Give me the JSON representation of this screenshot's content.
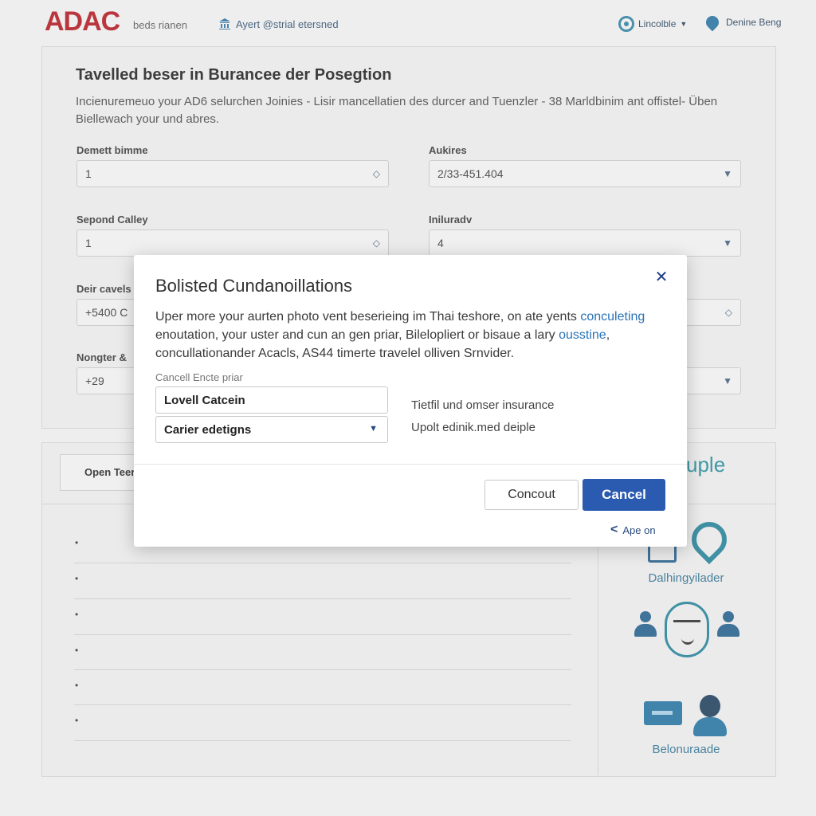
{
  "header": {
    "logo": "ADAC",
    "logo_sub": "beds rianen",
    "link": "Ayert @strial etersned",
    "lang": "Lincolble",
    "account": "Denine Beng"
  },
  "form": {
    "title": "Tavelled beser in Burancee der Posegtion",
    "description": "Incienuremeuo your AD6 selurchen Joinies - Lisir mancellatien des durcer and Tuenzler - 38 Marldbinim ant offistel- Üben Biellewach your und abres.",
    "fields": [
      {
        "label": "Demett bimme",
        "value": "1"
      },
      {
        "label": "Aukires",
        "value": "2/33-451.404"
      },
      {
        "label": "Sepond Calley",
        "value": "1"
      },
      {
        "label": "Iniluradv",
        "value": "4"
      },
      {
        "label": "Deir cavels",
        "value": "+5400 C"
      },
      {
        "label": "Nongter &",
        "value": "+29"
      }
    ]
  },
  "lower": {
    "tab": "Open Teer",
    "side_title": "uple",
    "side_label_1": "Dalhingyilader",
    "side_label_2": "Belonuraade",
    "bullets": [
      "•",
      "•",
      "•",
      "•",
      "•",
      "•"
    ]
  },
  "modal": {
    "title": "Bolisted Cundanoillations",
    "body_1": "Uper more your aurten photo vent beserieing im Thai teshore, on ate yents ",
    "body_link_1": "conculeting",
    "body_2": " enoutation, your uster and cun an gen priar, Bilelopliert or bisaue a lary ",
    "body_link_2": "ousstine",
    "body_3": ", concullationander Acacls, AS44 timerte travelel olliven Srnvider.",
    "input_label": "Cancell Encte priar",
    "input_value": "Lovell Catcein",
    "select_value": "Carier edetigns",
    "info_1": "Tietfil und omser insurance",
    "info_2": "Upolt edinik.med deiple",
    "secondary_button": "Concout",
    "primary_button": "Cancel",
    "back_link": "Ape on",
    "primary_color": "#2a5bb0"
  }
}
